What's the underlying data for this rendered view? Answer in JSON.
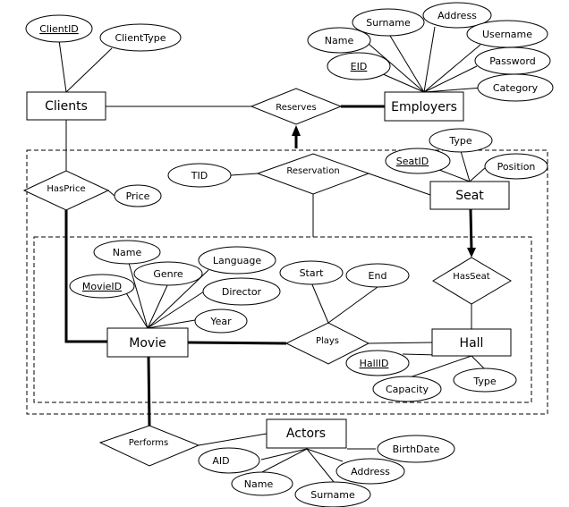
{
  "diagram": {
    "type": "ER diagram",
    "entities": {
      "clients": "Clients",
      "employers": "Employers",
      "seat": "Seat",
      "movie": "Movie",
      "hall": "Hall",
      "actors": "Actors"
    },
    "relationships": {
      "reserves": "Reserves",
      "reservation": "Reservation",
      "hasprice": "HasPrice",
      "hasseat": "HasSeat",
      "plays": "Plays",
      "performs": "Performs"
    },
    "attributes": {
      "clients": {
        "clientid": "ClientID",
        "clienttype": "ClientType"
      },
      "employers": {
        "name": "Name",
        "surname": "Surname",
        "address": "Address",
        "username": "Username",
        "password": "Password",
        "category": "Category",
        "eid": "EID"
      },
      "seat": {
        "type": "Type",
        "seatid": "SeatID",
        "position": "Position"
      },
      "reservation": {
        "tid": "TID"
      },
      "hasprice": {
        "price": "Price"
      },
      "movie": {
        "name": "Name",
        "genre": "Genre",
        "language": "Language",
        "movieid": "MovieID",
        "director": "Director",
        "year": "Year"
      },
      "plays": {
        "start": "Start",
        "end": "End"
      },
      "hall": {
        "hallid": "HallID",
        "capacity": "Capacity",
        "type": "Type"
      },
      "actors": {
        "aid": "AID",
        "name": "Name",
        "surname": "Surname",
        "address": "Address",
        "birthdate": "BirthDate"
      }
    },
    "key_attributes": [
      "ClientID",
      "EID",
      "SeatID",
      "MovieID",
      "HallID"
    ]
  }
}
